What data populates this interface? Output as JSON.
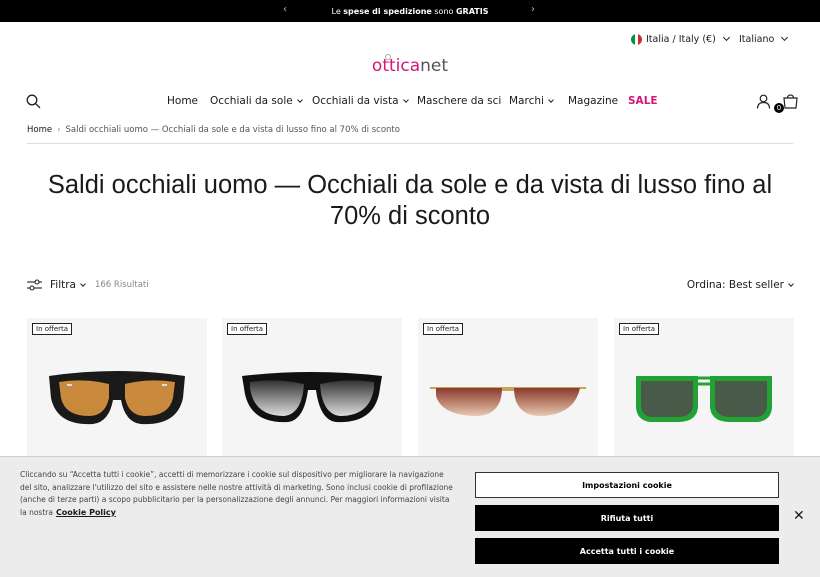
{
  "announcement": {
    "pre": "Le ",
    "bold1": "spese di spedizione",
    "mid": " sono ",
    "bold2": "GRATIS"
  },
  "locale": {
    "country": "Italia / Italy (€)",
    "language": "Italiano"
  },
  "logo": {
    "part1": "ottica",
    "part2": "net"
  },
  "nav": {
    "home": "Home",
    "sunglasses": "Occhiali da sole",
    "eyeglasses": "Occhiali da vista",
    "ski": "Maschere da sci",
    "brands": "Marchi",
    "magazine": "Magazine",
    "sale": "SALE"
  },
  "cart": {
    "count": "0"
  },
  "breadcrumb": {
    "home": "Home",
    "separator": "›",
    "current": "Saldi occhiali uomo — Occhiali da sole e da vista di lusso fino al 70% di sconto"
  },
  "page": {
    "title": "Saldi occhiali uomo — Occhiali da sole e da vista di lusso fino al 70% di sconto"
  },
  "toolbar": {
    "filter": "Filtra",
    "results": "166 Risultati",
    "sort": "Ordina: Best seller"
  },
  "products": [
    {
      "badge": "In offerta"
    },
    {
      "badge": "In offerta"
    },
    {
      "badge": "In offerta"
    },
    {
      "badge": "In offerta"
    }
  ],
  "cookie_banner": {
    "text": "Cliccando su “Accetta tutti i cookie”, accetti di memorizzare i cookie sul dispositivo per migliorare la navigazione del sito, analizzare l'utilizzo del sito e assistere nelle nostre attività di marketing. Sono inclusi cookie di profilazione (anche di terze parti) a scopo pubblicitario per la personalizzazione degli annunci. Per maggiori informazioni visita la nostra",
    "policy_link": "Cookie Policy",
    "settings_button": "Impostazioni cookie",
    "reject_button": "Rifiuta tutti",
    "accept_button": "Accetta tutti i cookie",
    "close": "✕"
  },
  "colors": {
    "brand": "#d1177a",
    "black": "#000000",
    "card_bg": "#f5f5f5"
  }
}
